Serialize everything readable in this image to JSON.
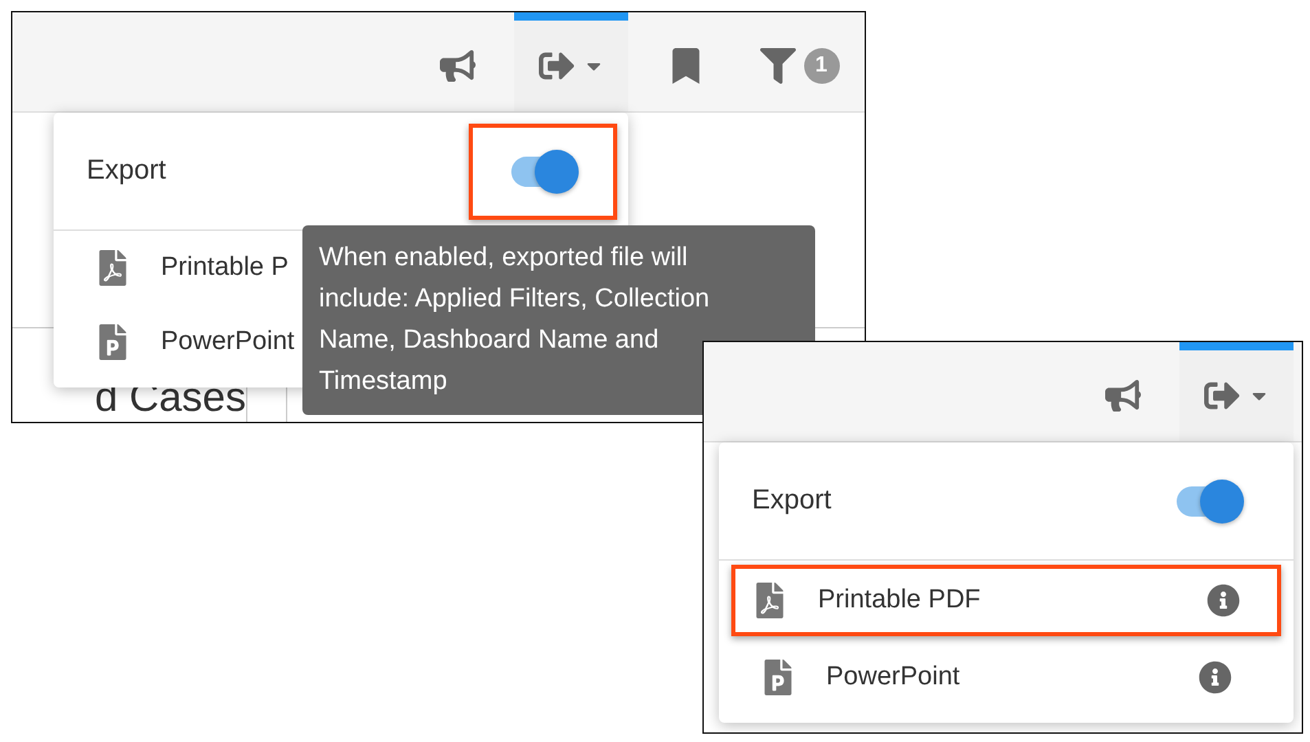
{
  "panels": [
    {
      "toolbar": [
        {
          "kind": "megaphone",
          "selected": false
        },
        {
          "kind": "export",
          "selected": true
        },
        {
          "kind": "bookmark",
          "selected": false
        },
        {
          "kind": "filter",
          "selected": false,
          "badge": "1"
        }
      ],
      "menu": {
        "title": "Export",
        "toggle_on": true,
        "toggle_callout": true,
        "show_info": false,
        "items": [
          {
            "label": "Printable P",
            "kind": "pdf",
            "callout": false
          },
          {
            "label": "PowerPoint",
            "kind": "ppt",
            "callout": false
          }
        ]
      },
      "tooltip": "When enabled, exported file will include: Applied Filters, Collection Name, Dashboard Name and Timestamp",
      "background_heading": "d Cases"
    },
    {
      "toolbar": [
        {
          "kind": "megaphone",
          "selected": false
        },
        {
          "kind": "export",
          "selected": true
        }
      ],
      "menu": {
        "title": "Export",
        "toggle_on": true,
        "toggle_callout": false,
        "show_info": true,
        "items": [
          {
            "label": "Printable PDF",
            "kind": "pdf",
            "callout": true
          },
          {
            "label": "PowerPoint",
            "kind": "ppt",
            "callout": false
          }
        ]
      }
    }
  ]
}
